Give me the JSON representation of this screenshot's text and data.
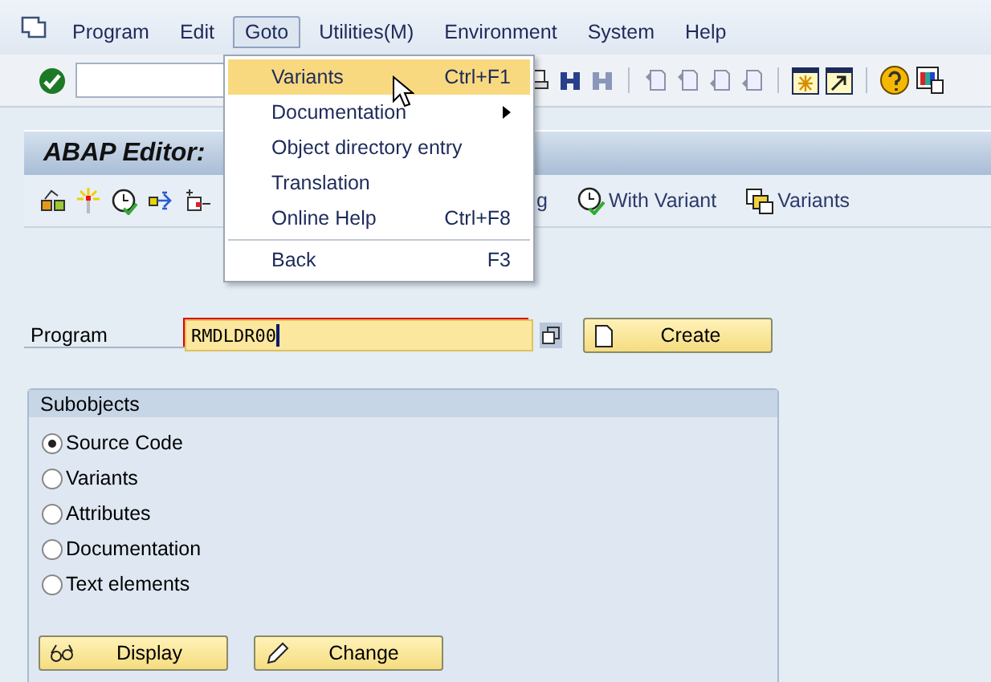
{
  "menu_bar": {
    "items": [
      {
        "label": "Program",
        "selected": false
      },
      {
        "label": "Edit",
        "selected": false
      },
      {
        "label": "Goto",
        "selected": true
      },
      {
        "label": "Utilities(M)",
        "selected": false
      },
      {
        "label": "Environment",
        "selected": false
      },
      {
        "label": "System",
        "selected": false
      },
      {
        "label": "Help",
        "selected": false
      }
    ]
  },
  "dropdown": {
    "items": [
      {
        "label": "Variants",
        "shortcut": "Ctrl+F1",
        "selected": true,
        "submenu": false,
        "separator_before": false
      },
      {
        "label": "Documentation",
        "selected": false,
        "submenu": true,
        "separator_before": false
      },
      {
        "label": "Object directory entry",
        "selected": false,
        "submenu": false,
        "separator_before": false
      },
      {
        "label": "Translation",
        "selected": false,
        "submenu": false,
        "separator_before": false
      },
      {
        "label": "Online Help",
        "shortcut": "Ctrl+F8",
        "selected": false,
        "submenu": false,
        "separator_before": false
      },
      {
        "label": "Back",
        "shortcut": "F3",
        "selected": false,
        "submenu": false,
        "separator_before": true
      }
    ]
  },
  "screen": {
    "title": "ABAP Editor:"
  },
  "app_toolbar": {
    "partial_label": "g",
    "buttons": [
      {
        "label": "With Variant",
        "kind": "clock"
      },
      {
        "label": "Variants",
        "kind": "variants"
      }
    ]
  },
  "program": {
    "label": "Program",
    "value": "RMDLDR00",
    "create_label": "Create"
  },
  "subobjects": {
    "title": "Subobjects",
    "options": [
      {
        "label": "Source Code",
        "selected": true
      },
      {
        "label": "Variants",
        "selected": false
      },
      {
        "label": "Attributes",
        "selected": false
      },
      {
        "label": "Documentation",
        "selected": false
      },
      {
        "label": "Text elements",
        "selected": false
      }
    ],
    "buttons": [
      {
        "label": "Display",
        "kind": "glasses"
      },
      {
        "label": "Change",
        "kind": "pencil"
      }
    ]
  }
}
